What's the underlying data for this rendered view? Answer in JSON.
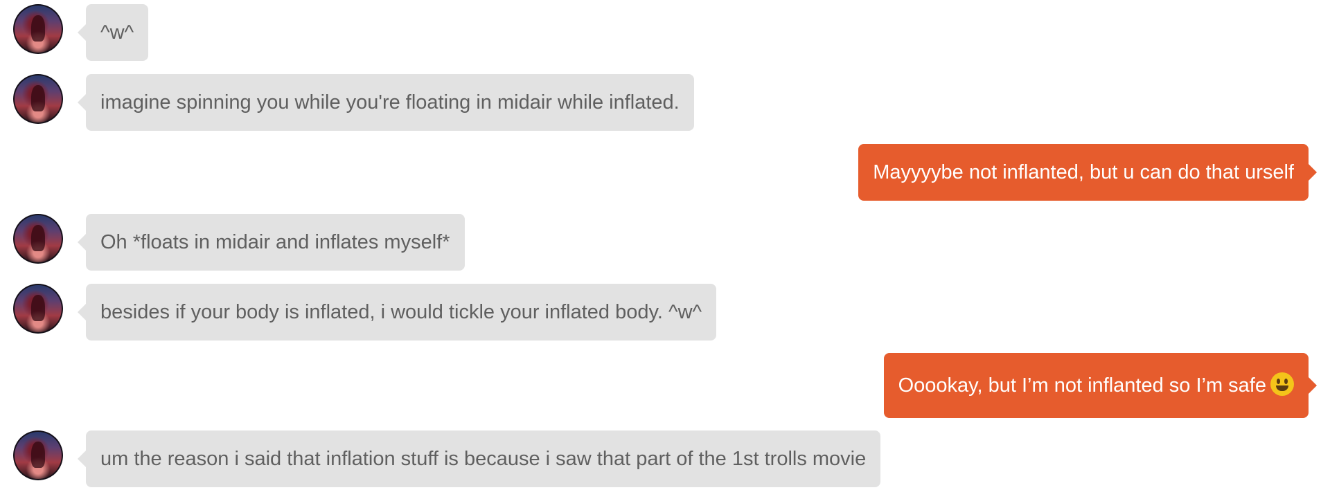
{
  "messages": [
    {
      "from": "them",
      "avatar_icon": "user-avatar-icon",
      "text": "^w^"
    },
    {
      "from": "them",
      "avatar_icon": "user-avatar-icon",
      "text": "imagine spinning you while you're floating in midair while inflated."
    },
    {
      "from": "me",
      "text": "Mayyyybe not inflanted, but u can do that urself"
    },
    {
      "from": "them",
      "avatar_icon": "user-avatar-icon",
      "text": "Oh *floats in midair and inflates myself*"
    },
    {
      "from": "them",
      "avatar_icon": "user-avatar-icon",
      "text": "besides if your body is inflated, i would tickle your inflated body. ^w^"
    },
    {
      "from": "me",
      "text": "Ooookay, but I’m not inflanted so I’m safe",
      "emoji": "grinning-face-emoji"
    },
    {
      "from": "them",
      "avatar_icon": "user-avatar-icon",
      "text": "um the reason i said that inflation stuff is because i saw that part of the 1st trolls movie"
    }
  ],
  "colors": {
    "incoming_bubble": "#e2e2e2",
    "incoming_text": "#5f5f5f",
    "outgoing_bubble": "#e65c2d",
    "outgoing_text": "#ffffff"
  }
}
